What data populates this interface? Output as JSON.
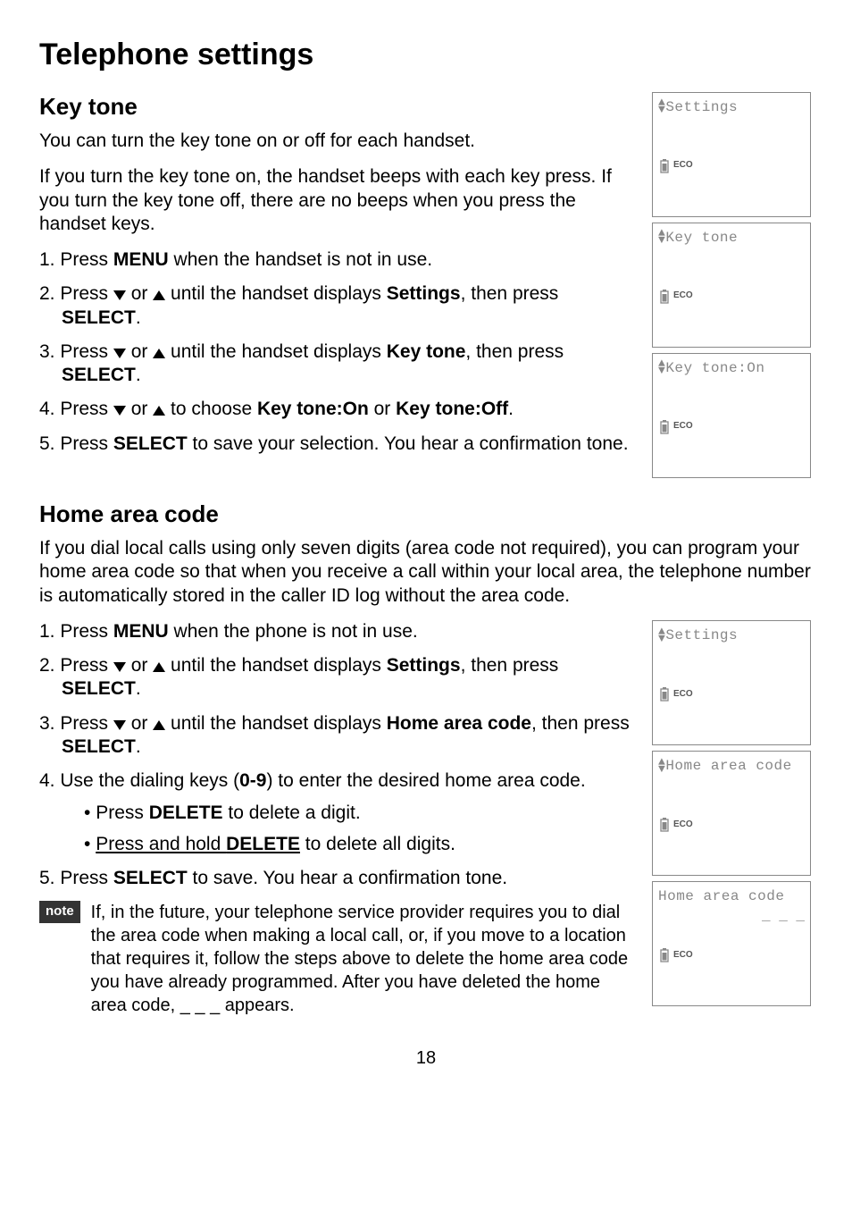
{
  "page_title": "Telephone settings",
  "page_number": "18",
  "key_tone": {
    "heading": "Key tone",
    "intro": "You can turn the key tone on or off for each handset.",
    "desc": "If you turn the key tone on, the handset beeps with each key press. If you turn the key tone off, there are no beeps when you press the handset keys.",
    "step1_a": "Press ",
    "step1_b": "MENU",
    "step1_c": " when the handset is not in use.",
    "step2_a": "Press ",
    "step2_b": " or ",
    "step2_c": " until the handset displays ",
    "step2_d": "Settings",
    "step2_e": ", then press ",
    "step2_f": "SELECT",
    "step2_g": ".",
    "step3_a": "Press ",
    "step3_b": " or ",
    "step3_c": " until the handset displays ",
    "step3_d": "Key tone",
    "step3_e": ", then press ",
    "step3_f": "SELECT",
    "step3_g": ".",
    "step4_a": "Press ",
    "step4_b": " or ",
    "step4_c": " to choose ",
    "step4_d": "Key tone:On",
    "step4_e": " or ",
    "step4_f": "Key tone:Off",
    "step4_g": ".",
    "step5_a": "Press ",
    "step5_b": "SELECT",
    "step5_c": " to save your selection. You hear a confirmation tone."
  },
  "hac": {
    "heading": "Home area code",
    "desc": "If you dial local calls using only seven digits (area code not required), you can program your home area code so that when you receive a call within your local area, the telephone number is automatically stored in the caller ID log without the area code.",
    "step1_a": "Press ",
    "step1_b": "MENU",
    "step1_c": " when the phone is not in use.",
    "step2_a": "Press ",
    "step2_b": " or ",
    "step2_c": " until the handset displays ",
    "step2_d": "Settings",
    "step2_e": ", then press ",
    "step2_f": "SELECT",
    "step2_g": ".",
    "step3_a": "Press ",
    "step3_b": " or ",
    "step3_c": " until the handset displays ",
    "step3_d": "Home area code",
    "step3_e": ", then press ",
    "step3_f": "SELECT",
    "step3_g": ".",
    "step4_a": "Use the dialing keys (",
    "step4_b": "0-9",
    "step4_c": ") to enter the desired home area code.",
    "sub1_a": "Press ",
    "sub1_b": "DELETE",
    "sub1_c": " to delete a digit.",
    "sub2_a": "Press and hold ",
    "sub2_b": "DELETE",
    "sub2_c": " to delete all digits.",
    "step5_a": "Press ",
    "step5_b": "SELECT",
    "step5_c": " to save. You hear a confirmation tone.",
    "note_label": "note",
    "note_text": "If, in the future, your telephone service provider requires you to dial the area code when making a local call, or, if you move to a location that requires it, follow the steps above to delete the home area code you have already programmed. After you have deleted the home area code, _ _ _ appears."
  },
  "lcd": {
    "eco": "ECO",
    "settings": "Settings",
    "key_tone": "Key tone",
    "key_tone_on": "Key tone:On",
    "home_area_code_menu": "Home area code",
    "home_area_code_entry": "Home area code",
    "blanks": "_ _ _"
  }
}
